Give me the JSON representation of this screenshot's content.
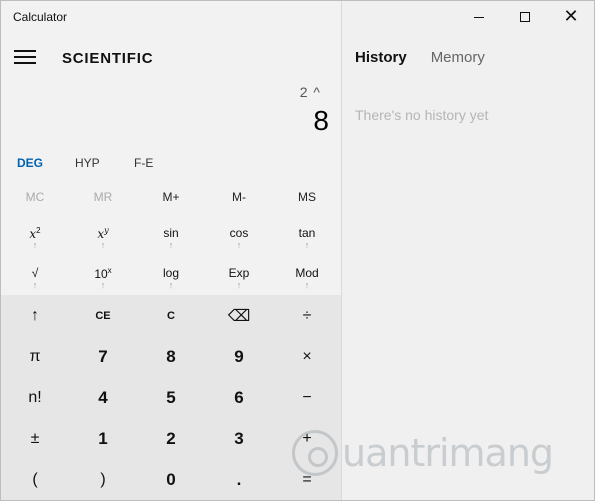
{
  "window": {
    "title": "Calculator",
    "minimize_icon": "minimize-icon",
    "maximize_icon": "maximize-icon",
    "close_icon": "close-icon",
    "close_glyph": "✕"
  },
  "header": {
    "menu_icon": "hamburger-menu-icon",
    "mode": "SCIENTIFIC"
  },
  "display": {
    "expression": "2 ^",
    "result": "8"
  },
  "angle": {
    "options": [
      "DEG",
      "HYP",
      "F-E"
    ],
    "active": "DEG",
    "active_color": "#0063b1"
  },
  "memory": {
    "buttons": [
      {
        "label": "MC",
        "enabled": false
      },
      {
        "label": "MR",
        "enabled": false
      },
      {
        "label": "M+",
        "enabled": true
      },
      {
        "label": "M-",
        "enabled": true
      },
      {
        "label": "MS",
        "enabled": true
      }
    ]
  },
  "functions": {
    "row1": [
      {
        "label": "x",
        "sup": "2",
        "italic": true
      },
      {
        "label": "x",
        "sup": "y",
        "italic": true
      },
      {
        "label": "sin"
      },
      {
        "label": "cos"
      },
      {
        "label": "tan"
      }
    ],
    "row2": [
      {
        "label": "√"
      },
      {
        "label": "10",
        "sup": "x"
      },
      {
        "label": "log"
      },
      {
        "label": "Exp"
      },
      {
        "label": "Mod"
      }
    ],
    "shift_marker": "↑"
  },
  "keypad": {
    "rows": [
      [
        {
          "label": "↑",
          "cls": "sym"
        },
        {
          "label": "CE",
          "cls": "sm"
        },
        {
          "label": "C",
          "cls": "sm"
        },
        {
          "label": "⌫",
          "cls": "sym"
        },
        {
          "label": "÷",
          "cls": "sym"
        }
      ],
      [
        {
          "label": "π",
          "cls": "sym"
        },
        {
          "label": "7",
          "cls": "num"
        },
        {
          "label": "8",
          "cls": "num"
        },
        {
          "label": "9",
          "cls": "num"
        },
        {
          "label": "×",
          "cls": "sym"
        }
      ],
      [
        {
          "label": "n!",
          "cls": "sym"
        },
        {
          "label": "4",
          "cls": "num"
        },
        {
          "label": "5",
          "cls": "num"
        },
        {
          "label": "6",
          "cls": "num"
        },
        {
          "label": "−",
          "cls": "sym"
        }
      ],
      [
        {
          "label": "±",
          "cls": "sym"
        },
        {
          "label": "1",
          "cls": "num"
        },
        {
          "label": "2",
          "cls": "num"
        },
        {
          "label": "3",
          "cls": "num"
        },
        {
          "label": "+",
          "cls": "sym"
        }
      ],
      [
        {
          "label": "(",
          "cls": "sym"
        },
        {
          "label": ")",
          "cls": "sym"
        },
        {
          "label": "0",
          "cls": "num"
        },
        {
          "label": ".",
          "cls": "num"
        },
        {
          "label": "=",
          "cls": "sym"
        }
      ]
    ]
  },
  "history_panel": {
    "tabs": [
      "History",
      "Memory"
    ],
    "active_tab": "History",
    "empty_message": "There's no history yet"
  },
  "watermark": {
    "text": "uantrimang"
  }
}
